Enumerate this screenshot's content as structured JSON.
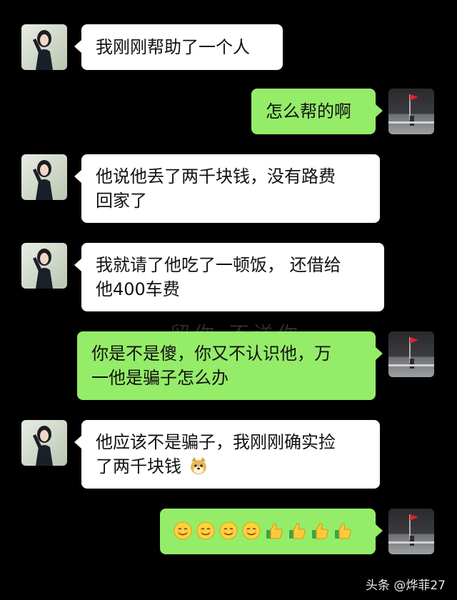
{
  "messages": [
    {
      "side": "left",
      "text": "我刚刚帮助了一个人"
    },
    {
      "side": "right",
      "text": "怎么帮的啊"
    },
    {
      "side": "left",
      "text": "他说他丢了两千块钱，没有路费\n回家了"
    },
    {
      "side": "left",
      "text": "我就请了他吃了一顿饭， 还借给\n他400车费"
    },
    {
      "side": "right",
      "text": "你是不是傻，你又不认识他，万\n一他是骗子怎么办"
    },
    {
      "side": "left",
      "text": "他应该不是骗子，我刚刚确实捡\n了两千块钱",
      "trailing_emoji": "doge-emoji"
    },
    {
      "side": "right",
      "emojis": [
        "smile-emoji",
        "smile-emoji",
        "smile-emoji",
        "smile-emoji",
        "thumbs-up-emoji",
        "thumbs-up-emoji",
        "thumbs-up-emoji",
        "thumbs-up-emoji"
      ]
    }
  ],
  "watermark": {
    "text": "头条 @烨菲27"
  },
  "faint_overlay_text": "留你 不送你",
  "colors": {
    "background": "#000000",
    "left_bubble": "#ffffff",
    "right_bubble": "#95ec69",
    "text": "#111111"
  }
}
